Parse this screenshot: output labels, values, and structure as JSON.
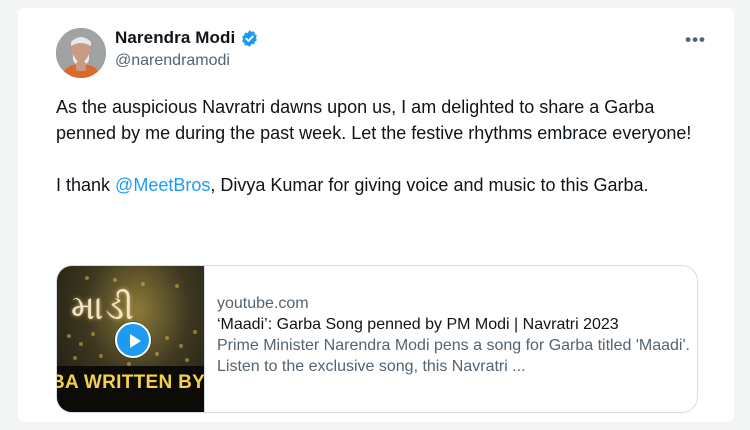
{
  "author": {
    "name": "Narendra Modi",
    "handle": "@narendramodi",
    "verified_color": "#1d9bf0"
  },
  "more_icon": "more-horizontal-icon",
  "tweet": {
    "paragraph1": "As the auspicious Navratri dawns upon us, I am delighted to share a Garba penned by me during the past week. Let the festive rhythms embrace everyone!",
    "thank_prefix": "I thank ",
    "mention": "@MeetBros",
    "thank_suffix": ", Divya Kumar for giving voice and music to this Garba."
  },
  "link_card": {
    "domain": "youtube.com",
    "title": "‘Maadi’: Garba Song penned by PM Modi | Navratri 2023",
    "description": "Prime Minister Narendra Modi pens a song for Garba titled 'Maadi'. Listen to the exclusive song, this Navratri ...",
    "thumbnail_title": "માડી",
    "thumbnail_caption": "BA WRITTEN BY PM M"
  },
  "colors": {
    "accent": "#1d9bf0",
    "secondary_text": "#536471",
    "primary_text": "#0f1419"
  }
}
